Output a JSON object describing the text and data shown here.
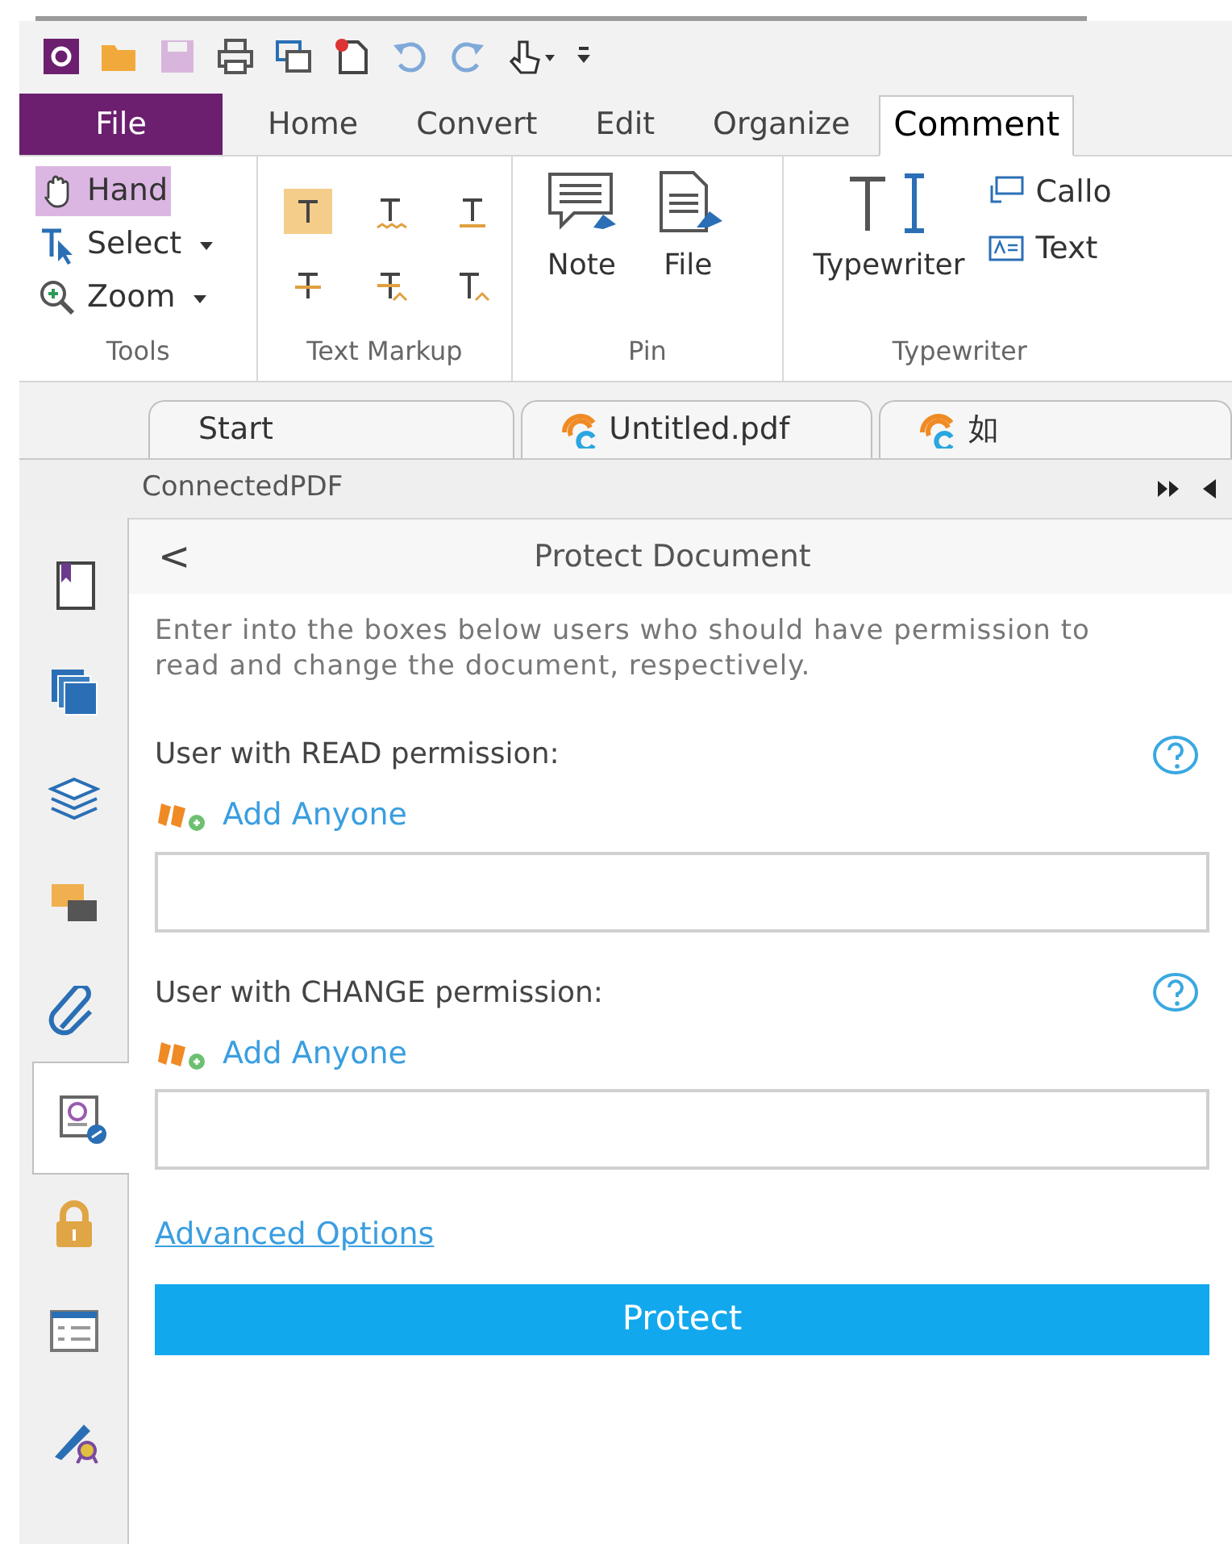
{
  "menu_tabs": [
    {
      "label": "File",
      "kind": "file",
      "selected": false
    },
    {
      "label": "Home",
      "kind": "tab",
      "selected": false
    },
    {
      "label": "Convert",
      "kind": "tab",
      "selected": false
    },
    {
      "label": "Edit",
      "kind": "tab",
      "selected": false
    },
    {
      "label": "Organize",
      "kind": "tab",
      "selected": false
    },
    {
      "label": "Comment",
      "kind": "tab",
      "selected": true
    }
  ],
  "ribbon": {
    "tools": {
      "label": "Tools",
      "items": [
        {
          "label": "Hand",
          "kind": "hand",
          "selected": true,
          "dropdown": false
        },
        {
          "label": "Select",
          "kind": "select",
          "selected": false,
          "dropdown": true
        },
        {
          "label": "Zoom",
          "kind": "zoom",
          "selected": false,
          "dropdown": true
        }
      ]
    },
    "text_markup": {
      "label": "Text Markup",
      "items": [
        {
          "selected": true
        },
        {
          "selected": false
        },
        {
          "selected": false
        },
        {
          "selected": false
        },
        {
          "selected": false
        },
        {
          "selected": false
        }
      ]
    },
    "pin": {
      "label": "Pin",
      "items": [
        {
          "label": "Note",
          "kind": "note"
        },
        {
          "label": "File",
          "kind": "file"
        }
      ]
    },
    "typewriter": {
      "label": "Typewriter",
      "main": "Typewriter",
      "items": [
        {
          "label": "Callo",
          "kind": "callout"
        },
        {
          "label": "Text",
          "kind": "textbox"
        }
      ]
    }
  },
  "doc_tabs": [
    {
      "label": "Start",
      "kind": "start"
    },
    {
      "label": "Untitled.pdf",
      "kind": "pdf"
    },
    {
      "label": "如",
      "kind": "pdf"
    }
  ],
  "panel_title": "ConnectedPDF",
  "sidebar": [
    {
      "kind": "bookmark",
      "selected": false
    },
    {
      "kind": "pages",
      "selected": false
    },
    {
      "kind": "layers",
      "selected": false
    },
    {
      "kind": "comments",
      "selected": false
    },
    {
      "kind": "attachment",
      "selected": false
    },
    {
      "kind": "connected",
      "selected": true
    },
    {
      "kind": "lock",
      "selected": false
    },
    {
      "kind": "form",
      "selected": false
    },
    {
      "kind": "signature",
      "selected": false
    }
  ],
  "protect": {
    "back": "<",
    "title": "Protect Document",
    "description": "Enter into the boxes below users who should have permission to read and change the document, respectively.",
    "sections": [
      {
        "label": "User with READ permission:",
        "add": "Add Anyone"
      },
      {
        "label": "User with CHANGE permission:",
        "add": "Add Anyone"
      }
    ],
    "advanced": "Advanced Options",
    "button": "Protect"
  }
}
